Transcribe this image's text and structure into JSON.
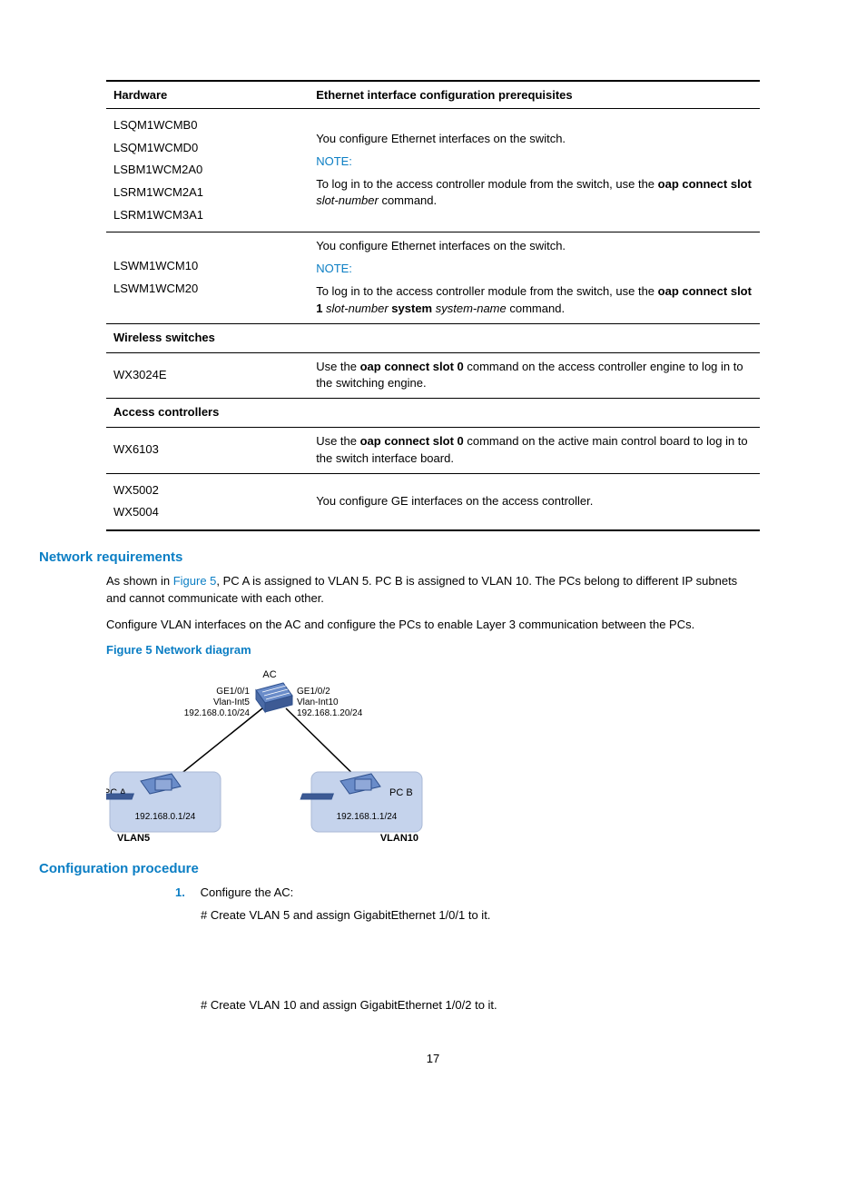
{
  "table": {
    "headers": [
      "Hardware",
      "Ethernet interface configuration prerequisites"
    ],
    "rows": [
      {
        "hw": "LSQM1WCMB0\nLSQM1WCMD0\nLSBM1WCM2A0\nLSRM1WCM2A1\nLSRM1WCM3A1",
        "parts": {
          "line1": "You configure Ethernet interfaces on the switch.",
          "note": "NOTE:",
          "line2a": "To log in to the access controller module from the switch, use the ",
          "bold1": "oap connect slot",
          "italic1": " slot-number ",
          "line2b": "command."
        }
      },
      {
        "hw": "LSWM1WCM10\nLSWM1WCM20",
        "parts": {
          "line1": "You configure Ethernet interfaces on the switch.",
          "note": "NOTE:",
          "line2a": "To log in to the access controller module from the switch, use the ",
          "bold1": "oap connect slot 1",
          "italic1": " slot-number ",
          "bold2": "system",
          "italic2": " system-name ",
          "line2b": "command."
        }
      },
      {
        "section": "Wireless switches"
      },
      {
        "hw": "WX3024E",
        "parts": {
          "pre": "Use the ",
          "bold1": "oap connect slot 0",
          "post": " command on the access controller engine to log in to the switching engine."
        }
      },
      {
        "section": "Access controllers"
      },
      {
        "hw": "WX6103",
        "parts": {
          "pre": "Use the ",
          "bold1": "oap connect slot 0",
          "post": " command on the active main control board to log in to the switch interface board."
        }
      },
      {
        "hw": "WX5002\nWX5004",
        "parts": {
          "plain": "You configure GE interfaces on the access controller."
        }
      }
    ]
  },
  "sections": {
    "netreq": {
      "title": "Network requirements",
      "p1_a": "As shown in ",
      "p1_link": "Figure 5",
      "p1_b": ", PC A is assigned to VLAN 5. PC B is assigned to VLAN 10. The PCs belong to different IP subnets and cannot communicate with each other.",
      "p2": "Configure VLAN interfaces on the AC and configure the PCs to enable Layer 3 communication between the PCs."
    },
    "figure": {
      "title": "Figure 5 Network diagram",
      "labels": {
        "ac": "AC",
        "left_if": "GE1/0/1",
        "left_vlanint": "Vlan-Int5",
        "left_ip": "192.168.0.10/24",
        "right_if": "GE1/0/2",
        "right_vlanint": "Vlan-Int10",
        "right_ip": "192.168.1.20/24",
        "pca": "PC A",
        "pca_ip": "192.168.0.1/24",
        "pca_vlan": "VLAN5",
        "pcb": "PC B",
        "pcb_ip": "192.168.1.1/24",
        "pcb_vlan": "VLAN10"
      }
    },
    "cfgproc": {
      "title": "Configuration procedure",
      "step1_num": "1.",
      "step1": "Configure the AC:",
      "step1a": "# Create VLAN 5 and assign GigabitEthernet 1/0/1 to it.",
      "step1b": "# Create VLAN 10 and assign GigabitEthernet 1/0/2 to it."
    }
  },
  "pagenum": "17"
}
